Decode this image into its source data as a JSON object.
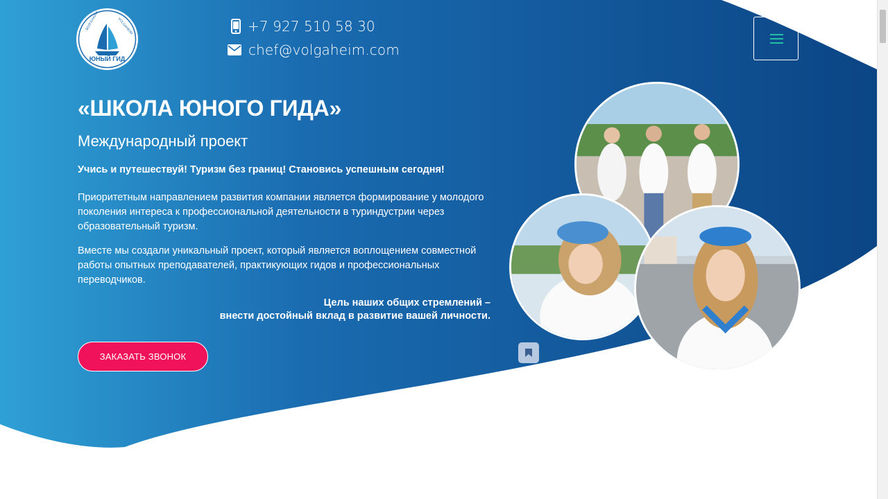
{
  "header": {
    "logo_text_top": "ВОЛГАХАЙМ",
    "logo_text_top_right": "VOLGAHEIM",
    "logo_text_main": "ЮНЫЙ ГИД",
    "phone": "+7 927 510 58 30",
    "email": "chef@volgaheim.com",
    "phone_icon": "mobile-phone-icon",
    "email_icon": "envelope-icon",
    "menu_icon": "hamburger-menu-icon"
  },
  "hero": {
    "title": "«ШКОЛА ЮНОГО ГИДА»",
    "subtitle": "Международный проект",
    "slogan": "Учись и путешествуй! Туризм без границ! Становись успешным сегодня!",
    "paragraph1": "Приоритетным направлением развития компании является формирование у молодого поколения интереса к профессиональной деятельности в туриндустрии через образовательный туризм.",
    "paragraph2": "Вместе мы создали уникальный проект, который является воплощением совместной работы опытных преподавателей, практикующих гидов и профессиональных переводчиков.",
    "goal_line1": "Цель наших общих стремлений –",
    "goal_line2": "внести достойный вклад в развитие вашей личности.",
    "cta_label": "ЗАКАЗАТЬ ЗВОНОК",
    "bookmark_icon": "bookmark-icon"
  },
  "colors": {
    "gradient_start": "#2a9fd6",
    "gradient_end": "#0d4a8a",
    "cta": "#f0135b",
    "menu_accent": "#24c0a6"
  }
}
